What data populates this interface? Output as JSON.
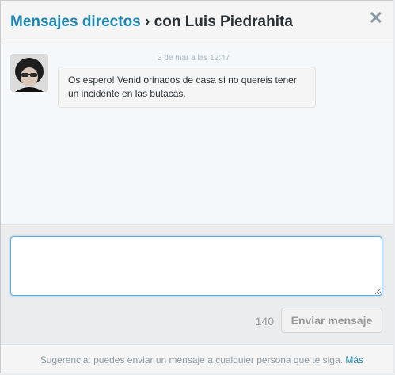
{
  "header": {
    "title_link": "Mensajes directos",
    "title_separator": "›",
    "title_suffix": "con Luis Piedrahita",
    "close_icon": "close-icon",
    "close_glyph": "✕"
  },
  "conversation": {
    "messages": [
      {
        "avatar_icon": "avatar",
        "timestamp": "3 de mar a las 12:47",
        "text": "Os espero! Venid orinados de casa si no quereis tener un incidente en las butacas."
      }
    ]
  },
  "composer": {
    "text_value": "",
    "char_counter": "140",
    "send_label": "Enviar mensaje"
  },
  "footer": {
    "hint": "Sugerencia: puedes enviar un mensaje a cualquier persona que te siga.",
    "more_link": "Más"
  },
  "colors": {
    "accent": "#1b87b0",
    "focus_border": "#5ab0e0",
    "text": "#292f33",
    "muted": "#8899a6"
  }
}
